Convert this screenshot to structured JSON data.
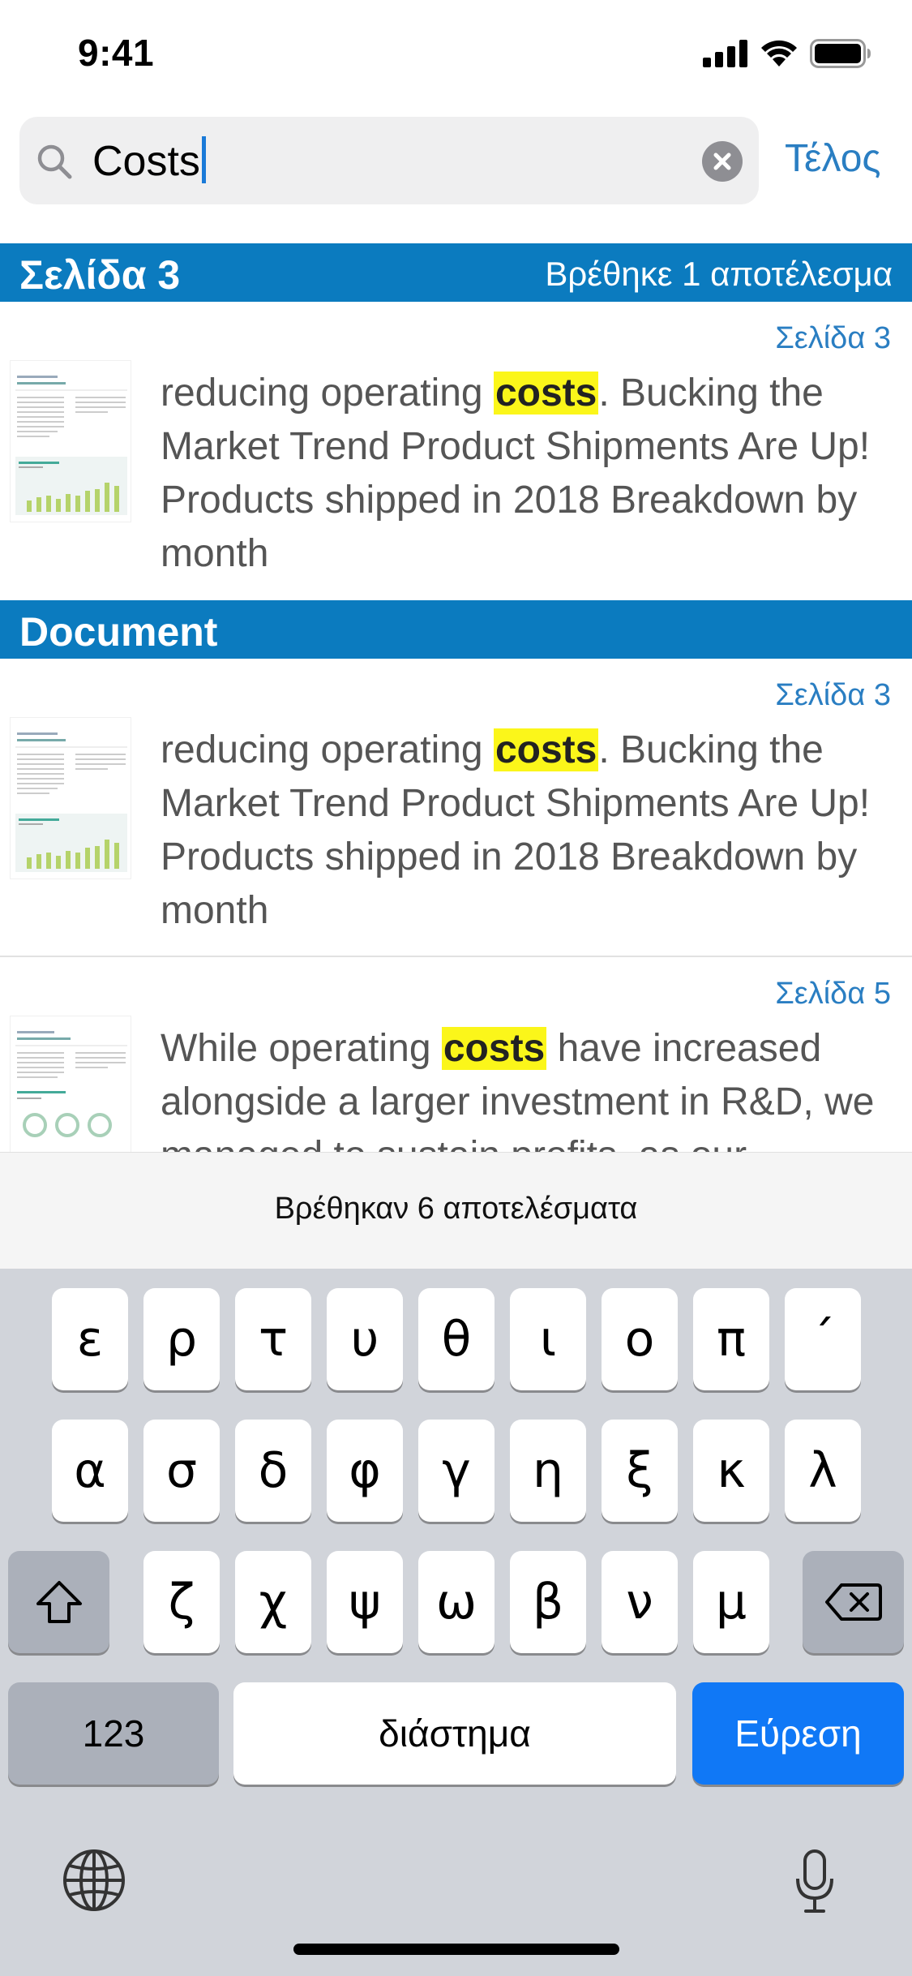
{
  "status_bar": {
    "time": "9:41"
  },
  "search": {
    "value": "Costs",
    "done_label": "Τέλος"
  },
  "sections": [
    {
      "title": "Σελίδα 3",
      "count": "Βρέθηκε 1 αποτέλεσμα"
    },
    {
      "title": "Document",
      "count": ""
    }
  ],
  "results": [
    {
      "page": "Σελίδα 3",
      "before": "reducing operating ",
      "match": "costs",
      "after": ". Bucking the Market Trend Product Shipments Are Up! Products shipped in 2018 Breakdown by month"
    },
    {
      "page": "Σελίδα 3",
      "before": "reducing operating ",
      "match": "costs",
      "after": ". Bucking the Market Trend Product Shipments Are Up! Products shipped in 2018 Breakdown by month"
    },
    {
      "page": "Σελίδα 5",
      "before": "While operating ",
      "match": "costs",
      "after": " have increased alongside a larger investment in R&D, we managed to sustain profits, as our"
    }
  ],
  "results_count": "Βρέθηκαν 6 αποτελέσματα",
  "keyboard": {
    "row1": [
      "ε",
      "ρ",
      "τ",
      "υ",
      "θ",
      "ι",
      "ο",
      "π",
      "´"
    ],
    "row2": [
      "α",
      "σ",
      "δ",
      "φ",
      "γ",
      "η",
      "ξ",
      "κ",
      "λ"
    ],
    "row3": [
      "ζ",
      "χ",
      "ψ",
      "ω",
      "β",
      "ν",
      "μ"
    ],
    "numbers_label": "123",
    "space_label": "διάστημα",
    "search_label": "Εύρεση"
  },
  "icons": {
    "signal": "cellular-signal-icon",
    "wifi": "wifi-icon",
    "battery": "battery-icon",
    "search": "search-icon",
    "clear": "clear-icon",
    "shift": "shift-icon",
    "delete": "delete-icon",
    "globe": "globe-icon",
    "mic": "microphone-icon"
  },
  "colors": {
    "accent": "#0b7bbf",
    "link": "#2a7ec2",
    "highlight": "#fbf61a",
    "search_key": "#1078f6"
  }
}
